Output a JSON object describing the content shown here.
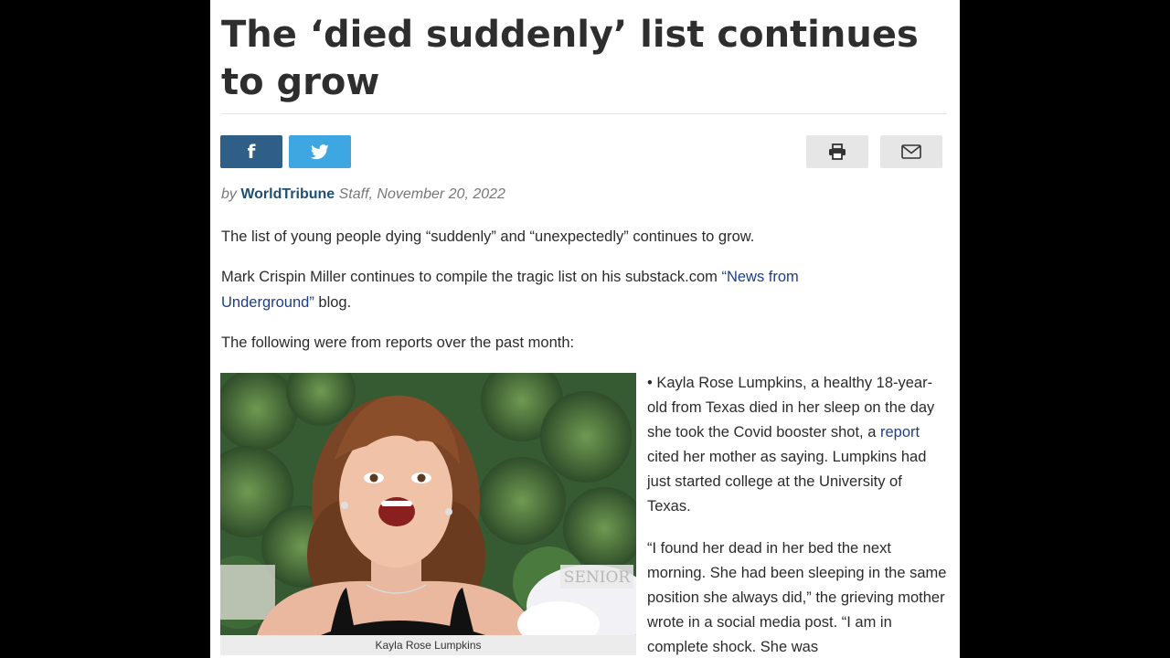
{
  "article": {
    "headline": "The ‘died suddenly’ list continues to grow",
    "byline": {
      "prefix": "by ",
      "org": "WorldTribune",
      "suffix": " Staff, November 20, 2022"
    },
    "p1": "The list of young people dying “suddenly” and “unexpectedly” continues to grow.",
    "p2": {
      "before": "Mark Crispin Miller continues to compile the tragic list on his substack.com ",
      "link": "“News from Underground”",
      "after": " blog."
    },
    "p3": "The following were from reports over the past month:",
    "photo_caption": "Kayla Rose Lumpkins",
    "photo_sign_text": "SENIOR",
    "side1": {
      "before": "• Kayla Rose Lumpkins, a healthy 18-year-old from Texas died in her sleep on the day she took the Covid booster shot, a ",
      "link": "report",
      "after": " cited her mother as saying. Lumpkins had just started college at the University of Texas."
    },
    "side2": "“I found her dead in her bed the next morning. She had been sleeping in the same position she always did,” the grieving mother wrote in a social media post. “I am in complete shock. She was"
  },
  "share": {
    "facebook_icon": "facebook-icon",
    "twitter_icon": "twitter-icon",
    "print_icon": "print-icon",
    "email_icon": "email-icon"
  },
  "colors": {
    "facebook": "#2f5f87",
    "twitter": "#3ea6e0",
    "link": "#1d3f8a",
    "brand": "#1f4f73"
  }
}
